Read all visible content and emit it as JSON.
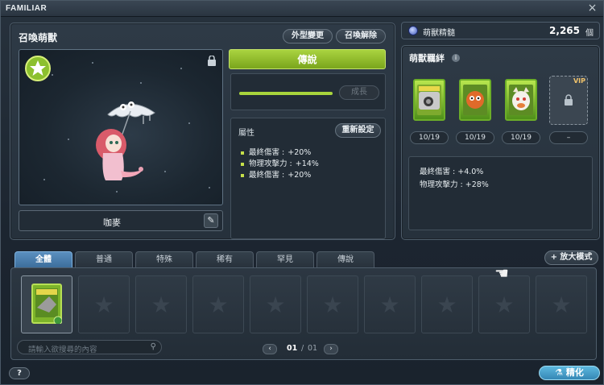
{
  "window": {
    "title": "FAMILIAR",
    "ghost_text": "",
    "close_label": "×"
  },
  "summon": {
    "heading": "召喚萌獸",
    "skin_button": "外型變更",
    "dismiss_button": "召喚解除",
    "familiar_name": "咖麥",
    "grade_label": "傳說",
    "growth_button": "成長",
    "growth_progress_percent": 100
  },
  "attributes": {
    "heading": "屬性",
    "reset_button": "重新設定",
    "items": [
      {
        "name": "最終傷害 :",
        "value": "+20%"
      },
      {
        "name": "物理攻擊力 :",
        "value": "+14%"
      },
      {
        "name": "最終傷害 :",
        "value": "+20%"
      }
    ]
  },
  "essence": {
    "label": "萌獸精髓",
    "amount": "2,265",
    "unit": "個"
  },
  "bond": {
    "heading": "萌獸羈絆",
    "info_icon": "i",
    "counts": [
      "10/19",
      "10/19",
      "10/19",
      "–"
    ],
    "vip_label": "VIP",
    "bonuses": [
      "最終傷害 : +4.0%",
      "物理攻擊力 : +28%"
    ]
  },
  "tabs": [
    "全體",
    "普通",
    "特殊",
    "稀有",
    "罕見",
    "傳說"
  ],
  "expand_button": "+ 放大模式",
  "search": {
    "placeholder": "請輸入欲搜尋的內容"
  },
  "pager": {
    "current": "01",
    "separator": "/",
    "total": "01",
    "prev": "‹",
    "next": "›"
  },
  "help_button": "?",
  "refine_button": "精化",
  "colors": {
    "accent_green": "#a8d43c",
    "accent_blue": "#4a9bc8",
    "panel_bg": "#26313c"
  }
}
